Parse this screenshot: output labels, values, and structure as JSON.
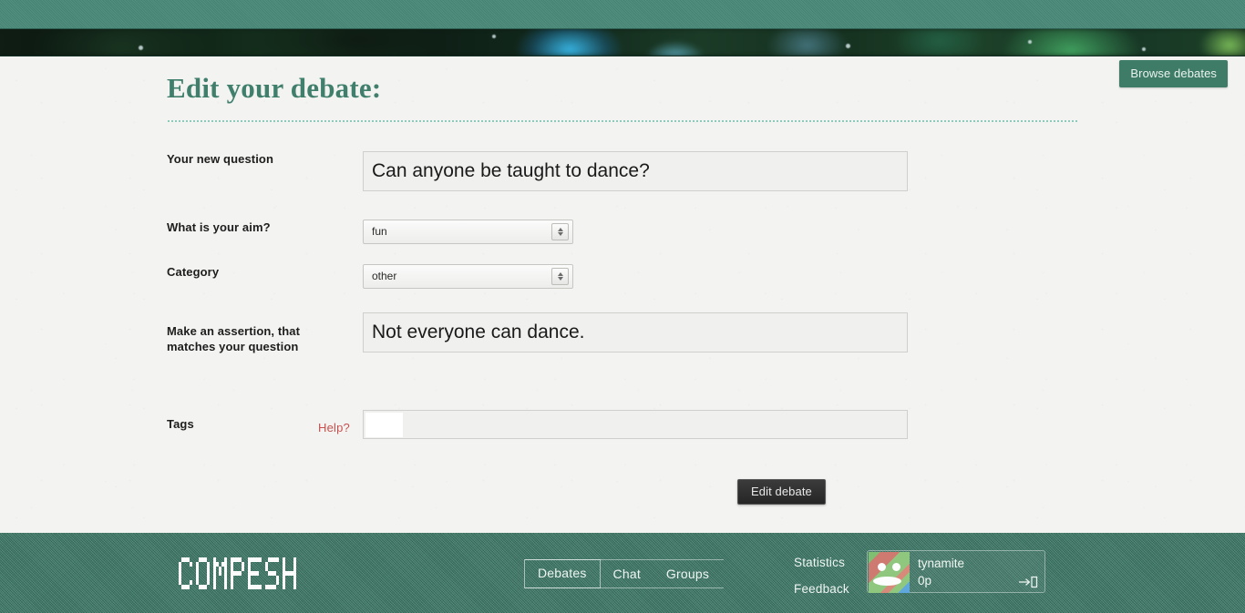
{
  "header": {
    "browse_button_label": "Browse debates"
  },
  "main": {
    "page_title": "Edit your debate:",
    "help_link_label": "Help?",
    "submit_label": "Edit debate",
    "fields": [
      {
        "key": "question",
        "label": "Your new question",
        "type": "text",
        "value": "Can anyone be taught to dance?"
      },
      {
        "key": "aim",
        "label": "What is your aim?",
        "type": "select",
        "value": "fun"
      },
      {
        "key": "category",
        "label": "Category",
        "type": "select",
        "value": "other"
      },
      {
        "key": "assertion",
        "label": "Make an assertion, that matches your question",
        "type": "text",
        "value": "Not everyone can dance."
      },
      {
        "key": "tags",
        "label": "Tags",
        "type": "text",
        "value": ""
      }
    ]
  },
  "footer": {
    "logo_text": "COMPESH",
    "nav": [
      {
        "label": "Debates",
        "active": true
      },
      {
        "label": "Chat",
        "active": false
      },
      {
        "label": "Groups",
        "active": false
      }
    ],
    "links": [
      {
        "label": "Statistics"
      },
      {
        "label": "Feedback"
      }
    ],
    "user": {
      "name": "tynamite",
      "points": "0p",
      "logout_icon": "logout-icon",
      "avatar_icon": "user-avatar-face"
    }
  },
  "colors": {
    "accent_teal": "#3f7f6c",
    "footer_teal": "#3d7a68",
    "help_red": "#c7504f",
    "button_dark": "#262626"
  }
}
